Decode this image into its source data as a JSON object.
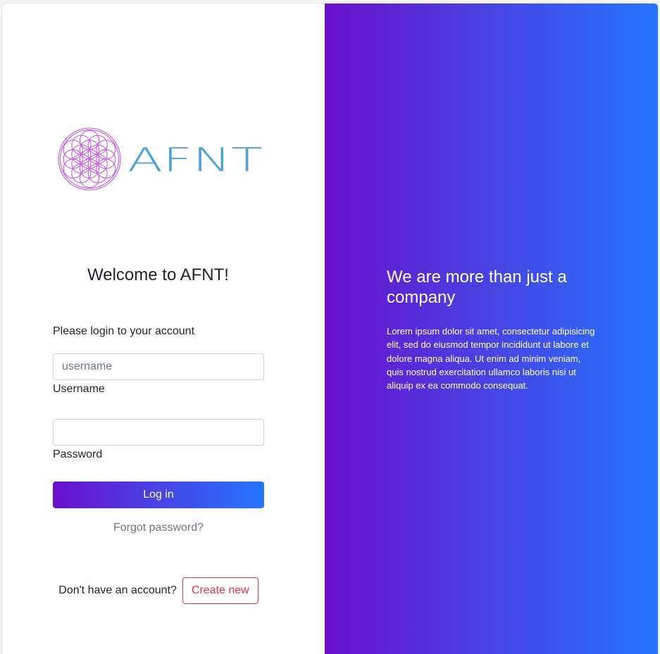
{
  "brand": {
    "logo_text": "AFNT",
    "logo_icon": "flower-of-life-icon",
    "logo_circle_color": "#c158dc",
    "logo_text_color": "#4ea3d8"
  },
  "login": {
    "welcome_title": "Welcome to AFNT!",
    "prompt": "Please login to your account",
    "username_placeholder": "username",
    "username_value": "",
    "username_label": "Username",
    "password_value": "",
    "password_label": "Password",
    "login_button": "Log in",
    "forgot_link": "Forgot password?",
    "no_account_text": "Don't have an account?",
    "create_button": "Create new"
  },
  "promo": {
    "heading": "We are more than just a company",
    "body": "Lorem ipsum dolor sit amet, consectetur adipisicing elit, sed do eiusmod tempor incididunt ut labore et dolore magna aliqua. Ut enim ad minim veniam, quis nostrud exercitation ullamco laboris nisi ut aliquip ex ea commodo consequat."
  },
  "colors": {
    "gradient_start": "#6a11cb",
    "gradient_end": "#2575fc",
    "danger": "#dc3545",
    "muted": "#6c757d"
  }
}
